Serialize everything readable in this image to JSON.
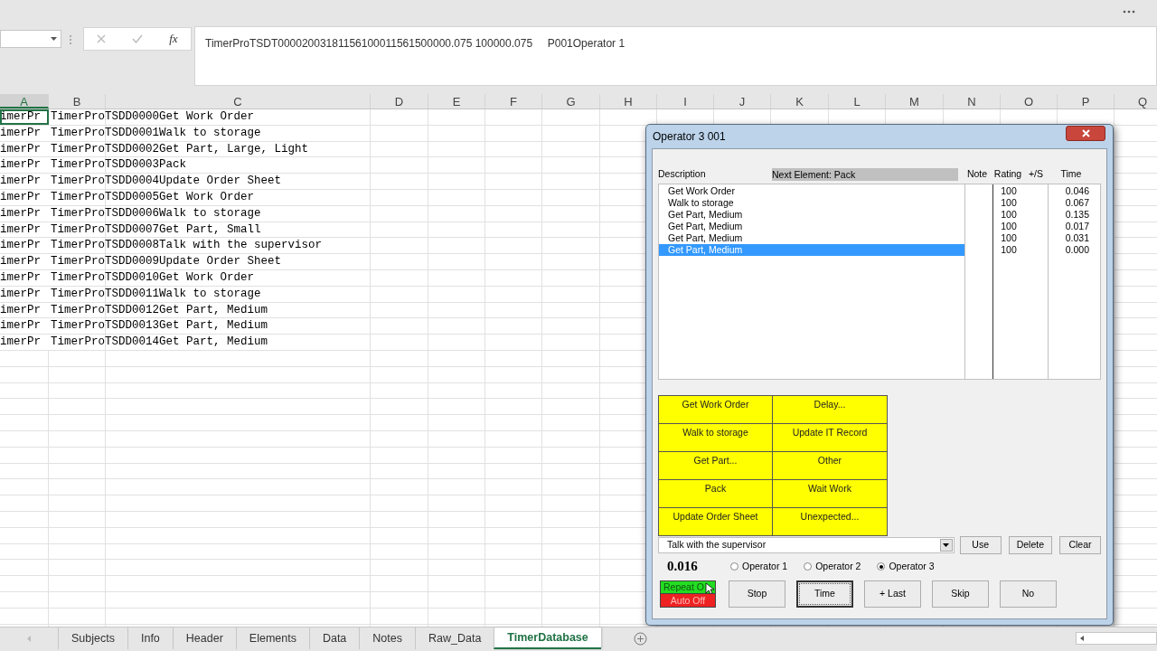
{
  "formula_bar": {
    "fx": "fx",
    "value": "TimerProTSDT00002003181156100011561500000.075 100000.075     P001Operator 1"
  },
  "columns": [
    {
      "label": "A",
      "selected": true
    },
    {
      "label": "B",
      "selected": false
    },
    {
      "label": "C",
      "selected": false
    },
    {
      "label": "D",
      "selected": false
    },
    {
      "label": "E",
      "selected": false
    },
    {
      "label": "F",
      "selected": false
    },
    {
      "label": "G",
      "selected": false
    },
    {
      "label": "H",
      "selected": false
    },
    {
      "label": "I",
      "selected": false
    },
    {
      "label": "J",
      "selected": false
    },
    {
      "label": "K",
      "selected": false
    },
    {
      "label": "L",
      "selected": false
    },
    {
      "label": "M",
      "selected": false
    },
    {
      "label": "N",
      "selected": false
    },
    {
      "label": "O",
      "selected": false
    },
    {
      "label": "P",
      "selected": false
    },
    {
      "label": "Q",
      "selected": false
    }
  ],
  "rows": [
    {
      "a": "imerPr",
      "b": "TimerProTSDD0000Get Work Order"
    },
    {
      "a": "imerPr",
      "b": "TimerProTSDD0001Walk to storage"
    },
    {
      "a": "imerPr",
      "b": "TimerProTSDD0002Get Part, Large, Light"
    },
    {
      "a": "imerPr",
      "b": "TimerProTSDD0003Pack"
    },
    {
      "a": "imerPr",
      "b": "TimerProTSDD0004Update Order Sheet"
    },
    {
      "a": "imerPr",
      "b": "TimerProTSDD0005Get Work Order"
    },
    {
      "a": "imerPr",
      "b": "TimerProTSDD0006Walk to storage"
    },
    {
      "a": "imerPr",
      "b": "TimerProTSDD0007Get Part, Small"
    },
    {
      "a": "imerPr",
      "b": "TimerProTSDD0008Talk with the supervisor"
    },
    {
      "a": "imerPr",
      "b": "TimerProTSDD0009Update Order Sheet"
    },
    {
      "a": "imerPr",
      "b": "TimerProTSDD0010Get Work Order"
    },
    {
      "a": "imerPr",
      "b": "TimerProTSDD0011Walk to storage"
    },
    {
      "a": "imerPr",
      "b": "TimerProTSDD0012Get Part, Medium"
    },
    {
      "a": "imerPr",
      "b": "TimerProTSDD0013Get Part, Medium"
    },
    {
      "a": "imerPr",
      "b": "TimerProTSDD0014Get Part, Medium"
    }
  ],
  "dialog": {
    "title": "Operator 3 001",
    "list_header": {
      "description": "Description",
      "next_element": "Next Element: Pack",
      "note": "Note",
      "rating": "Rating",
      "plus_s": "+/S",
      "time": "Time"
    },
    "list_rows": [
      {
        "description": "Get Work Order",
        "rating": "100",
        "time": "0.046",
        "selected": false
      },
      {
        "description": "Walk to storage",
        "rating": "100",
        "time": "0.067",
        "selected": false
      },
      {
        "description": "Get Part, Medium",
        "rating": "100",
        "time": "0.135",
        "selected": false
      },
      {
        "description": "Get Part, Medium",
        "rating": "100",
        "time": "0.017",
        "selected": false
      },
      {
        "description": "Get Part, Medium",
        "rating": "100",
        "time": "0.031",
        "selected": false
      },
      {
        "description": "Get Part, Medium",
        "rating": "100",
        "time": "0.000",
        "selected": true
      }
    ],
    "element_buttons": [
      "Get Work Order",
      "Delay...",
      "Walk to storage",
      "Update IT Record",
      "Get Part...",
      "Other",
      "Pack",
      "Wait Work",
      "Update Order Sheet",
      "Unexpected..."
    ],
    "combo": {
      "value": "Talk with the supervisor"
    },
    "combo_buttons": [
      "Use",
      "Delete",
      "Clear"
    ],
    "timer": "0.016",
    "operators": [
      {
        "label": "Operator 1",
        "selected": false
      },
      {
        "label": "Operator 2",
        "selected": false
      },
      {
        "label": "Operator 3",
        "selected": true
      }
    ],
    "repeat_toggle": "Repeat O",
    "auto_toggle": "Auto Off",
    "action_buttons": [
      {
        "label": "Stop",
        "focused": false
      },
      {
        "label": "Time",
        "focused": true
      },
      {
        "label": "+ Last",
        "focused": false
      },
      {
        "label": "Skip",
        "focused": false
      },
      {
        "label": "No",
        "focused": false
      }
    ]
  },
  "sheet_tabs": [
    {
      "label": "Subjects",
      "selected": false
    },
    {
      "label": "Info",
      "selected": false
    },
    {
      "label": "Header",
      "selected": false
    },
    {
      "label": "Elements",
      "selected": false
    },
    {
      "label": "Data",
      "selected": false
    },
    {
      "label": "Notes",
      "selected": false
    },
    {
      "label": "Raw_Data",
      "selected": false
    },
    {
      "label": "TimerDatabase",
      "selected": true
    }
  ]
}
